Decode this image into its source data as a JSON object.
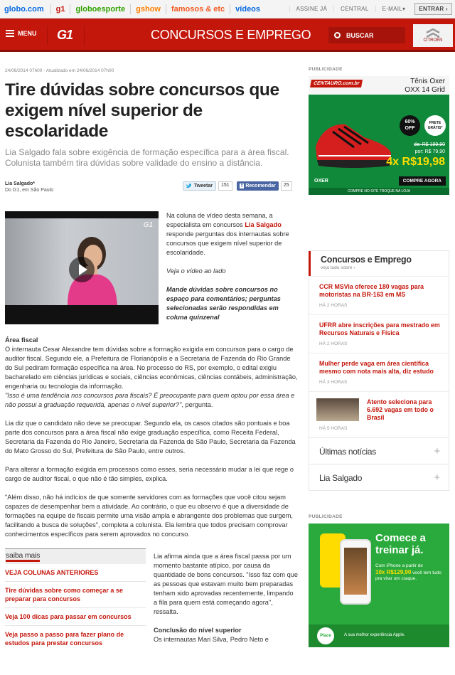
{
  "gbar": {
    "brand": "globo.com",
    "links": [
      {
        "label": "g1",
        "color": "#c4170c"
      },
      {
        "label": "globoesporte",
        "color": "#31a200"
      },
      {
        "label": "gshow",
        "color": "#ff7f00"
      },
      {
        "label": "famosos & etc",
        "color": "#f15a24"
      },
      {
        "label": "vídeos",
        "color": "#0669de"
      }
    ],
    "assine": "ASSINE JÁ",
    "central": "CENTRAL",
    "email": "E-MAIL▾",
    "entrar": "ENTRAR ›"
  },
  "header": {
    "menu": "MENU",
    "logo": "G1",
    "section": "CONCURSOS E EMPREGO",
    "search": "BUSCAR",
    "ad_brand": "CITROËN"
  },
  "article": {
    "date": "24/06/2014 07h00 - Atualizado em 24/06/2014 07h00",
    "title": "Tire dúvidas sobre concursos que exigem nível superior de escolaridade",
    "subtitle": "Lia Salgado fala sobre exigência de formação específica para a área fiscal. Colunista também tira dúvidas sobre validade do ensino a distância.",
    "author": "Lia Salgado*",
    "location": "Do G1, em São Paulo",
    "tweet_label": "Tweetar",
    "tweet_count": "151",
    "fb_label": "Recomendar",
    "fb_count": "25",
    "video_logo": "G1",
    "v1a": "Na coluna de vídeo desta semana, a especialista em concursos ",
    "v1b": "Lia Salgado",
    "v1c": " responde perguntas dos internautas sobre concursos que exigem nível superior de escolaridade.",
    "v2": "Veja o vídeo ao lado",
    "v3": "Mande dúvidas sobre concursos no espaço para comentários; perguntas selecionadas serão respondidas em coluna quinzenal",
    "h1": "Área fiscal",
    "p1": "O internauta Cesar Alexandre tem dúvidas sobre a formação exigida em concursos para o cargo de auditor fiscal. Segundo ele, a Prefeitura de Florianópolis e a Secretaria de Fazenda do Rio Grande do Sul pediram formação específica na área. No processo do RS, por exemplo, o edital exigiu bacharelado em ciências jurídicas e sociais, ciências econômicas, ciências contábeis, administração, engenharia ou tecnologia da informação.",
    "p1q": "\"Isso é uma tendência nos concursos para fiscais? É preocupante para quem optou por essa área e não possui a graduação requerida, apenas o nível superior?\"",
    "p1e": ", pergunta.",
    "p2": "Lia diz que o candidato não deve se preocupar. Segundo ela, os casos citados são pontuais e boa parte dos concursos para a área fiscal não exige graduação específica, como Receita Federal, Secretaria da Fazenda do Rio Janeiro, Secretaria da Fazenda de São Paulo, Secretaria da Fazenda do Mato Grosso do Sul, Prefeitura de São Paulo, entre outros.",
    "p3": "Para alterar a formação exigida em processos como esses, seria necessário mudar a lei que rege o cargo de auditor fiscal, o que não é tão simples, explica.",
    "p4": "\"Além disso, não há indícios de que somente servidores com as formações que você citou sejam capazes de desempenhar bem a atividade. Ao contrário, o que eu observo é que a diversidade de formações na equipe de fiscais permite uma visão ampla e abrangente dos problemas que surgem, facilitando a busca de soluções\", completa a colunista. Ela lembra que todos precisam comprovar conhecimentos específicos para serem aprovados no concurso.",
    "p5": "Lia afirma ainda que a área fiscal passa por um momento bastante atípico, por causa da quantidade de bons concursos. \"Isso faz com que as pessoas que estavam muito bem preparadas tenham sido aprovadas recentemente, limpando a fila para quem está começando agora\", ressalta.",
    "h2": "Conclusão do nível superior",
    "p6": "Os internautas Mari Silva, Pedro Neto e"
  },
  "saiba": {
    "title": "saiba mais",
    "items": [
      "VEJA COLUNAS ANTERIORES",
      "Tire dúvidas sobre como começar a se preparar para concursos",
      "Veja 100 dicas para passar em concursos",
      "Veja passo a passo para fazer plano de estudos para prestar concursos"
    ]
  },
  "ad1": {
    "label": "PUBLICIDADE",
    "store": "CENTAURO.com.br",
    "model1": "Tênis Oxer",
    "model2": "OXX 14 Grid",
    "discount": "60% OFF",
    "frete": "FRETE GRÁTIS*",
    "de": "de: R$ 199,90",
    "por": "por: R$ 79,90",
    "parcela": "4x R$19,98",
    "buy": "COMPRE AGORA",
    "oxer": "OXER",
    "foot": "COMPRE NO SITE  TROQUE NA LOJA"
  },
  "box": {
    "title": "Concursos e Emprego",
    "sub": "veja tudo sobre ›",
    "news": [
      {
        "t": "CCR MSVia oferece 180 vagas para motoristas na BR-163 em MS",
        "tm": "HÁ 2 HORAS"
      },
      {
        "t": "UFRR abre inscrições para mestrado em Recursos Naturais e Física",
        "tm": "HÁ 2 HORAS"
      },
      {
        "t": "Mulher perde vaga em área científica mesmo com nota mais alta, diz estudo",
        "tm": "HÁ 3 HORAS"
      },
      {
        "t": "Atento seleciona para 6.692 vagas em todo o Brasil",
        "tm": "HÁ 5 HORAS"
      }
    ],
    "acc1": "Últimas notícias",
    "acc2": "Lia Salgado",
    "plus": "+"
  },
  "ad2": {
    "label": "PUBLICIDADE",
    "headline": "Comece a treinar já.",
    "t1": "Com iPhone a partir de",
    "t2": "10x R$129,90",
    "t3": "você tem tudo pra virar um craque.",
    "place": "Place",
    "bottom": "A sua melhor experiência Apple."
  }
}
